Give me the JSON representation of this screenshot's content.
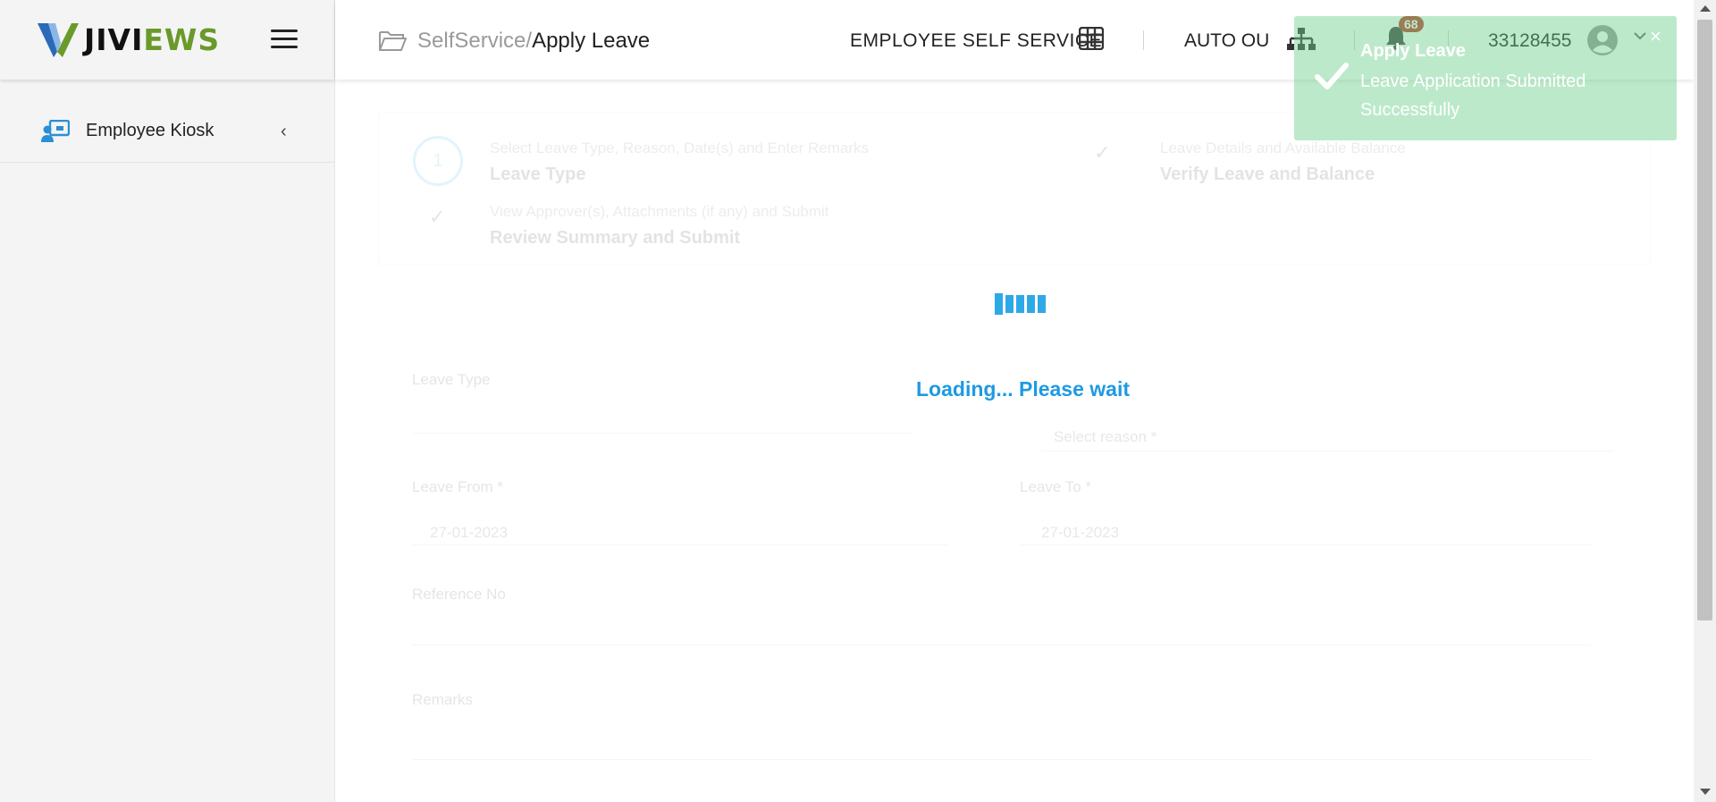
{
  "brand": {
    "logo_part1": "JIVI",
    "logo_part2": "EWS"
  },
  "sidebar": {
    "items": [
      {
        "label": "Employee Kiosk"
      }
    ]
  },
  "header": {
    "breadcrumb_root": "SelfService",
    "breadcrumb_sep": "/",
    "breadcrumb_current": "Apply Leave",
    "module": "EMPLOYEE SELF SERVICE",
    "ou": "AUTO OU",
    "notification_count": "68",
    "employee_id": "33128455"
  },
  "steps": [
    {
      "number": "1",
      "subtitle": "Select Leave Type, Reason, Date(s) and Enter Remarks",
      "title": "Leave Type"
    },
    {
      "subtitle": "Leave Details and Available Balance",
      "title": "Verify Leave and Balance"
    },
    {
      "subtitle": "View Approver(s), Attachments (if any) and Submit",
      "title": "Review Summary and Submit"
    }
  ],
  "form": {
    "leave_type_label": "Leave Type",
    "leave_type_value": "",
    "reason_value": "Select reason *",
    "leave_from_label": "Leave From *",
    "leave_from_value": "27-01-2023",
    "leave_to_label": "Leave To *",
    "leave_to_value": "27-01-2023",
    "reference_label": "Reference No",
    "remarks_label": "Remarks"
  },
  "loading": {
    "text": "Loading... Please wait"
  },
  "toast": {
    "title": "Apply Leave",
    "message": "Leave Application Submitted Successfully",
    "close": "×"
  },
  "colors": {
    "accent": "#1e9ae2",
    "brand_green": "#6a9a2a",
    "toast_green": "#6cce8b",
    "badge": "#c0392b"
  }
}
